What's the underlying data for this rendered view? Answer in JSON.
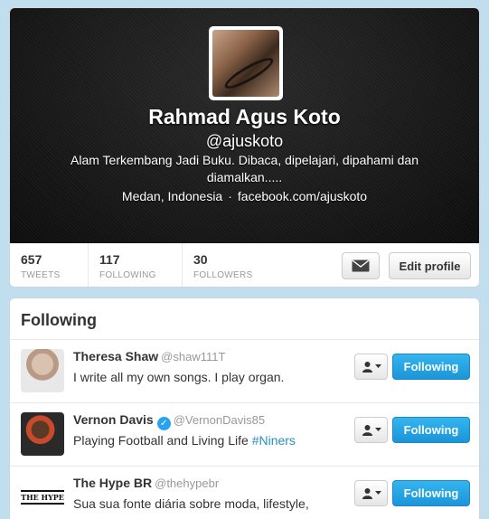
{
  "profile": {
    "fullname": "Rahmad Agus Koto",
    "screenname": "@ajuskoto",
    "bio": "Alam Terkembang Jadi Buku. Dibaca, dipelajari, dipahami dan diamalkan.....",
    "location": "Medan, Indonesia",
    "separator": "·",
    "url": "facebook.com/ajuskoto"
  },
  "stats": [
    {
      "value": "657",
      "label": "TWEETS"
    },
    {
      "value": "117",
      "label": "FOLLOWING"
    },
    {
      "value": "30",
      "label": "FOLLOWERS"
    }
  ],
  "actions": {
    "message_icon": "envelope-icon",
    "edit_profile_label": "Edit profile"
  },
  "following": {
    "title": "Following",
    "button_label": "Following",
    "users": [
      {
        "name": "Theresa Shaw",
        "handle": "@shaw111T",
        "verified": false,
        "bio": "I write all my own songs. I play organ.",
        "hashtag": ""
      },
      {
        "name": "Vernon Davis",
        "handle": "@VernonDavis85",
        "verified": true,
        "bio": "Playing Football and Living Life ",
        "hashtag": "#Niners"
      },
      {
        "name": "The Hype BR",
        "handle": "@thehypebr",
        "verified": false,
        "bio": "Sua sua fonte diária sobre moda, lifestyle,",
        "hashtag": "",
        "avatar_text": "THE HYPE"
      }
    ]
  },
  "colors": {
    "background": "#c0deed",
    "follow_button": "#1c95d8",
    "link": "#2a8fbd"
  }
}
